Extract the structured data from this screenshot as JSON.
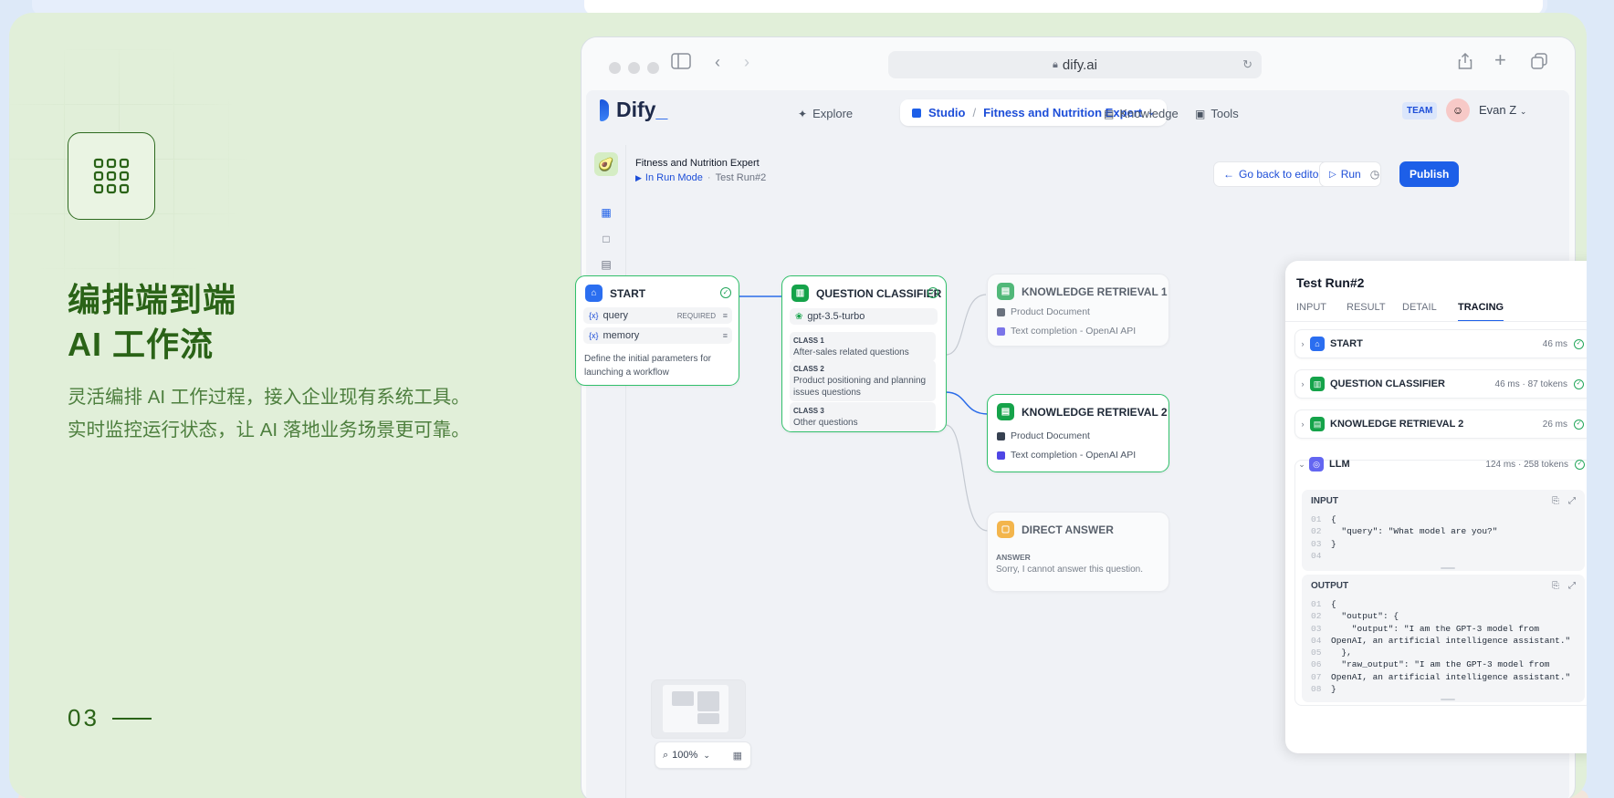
{
  "feature": {
    "title_line1": "编排端到端",
    "title_line2": "AI 工作流",
    "desc_line1": "灵活编排 AI 工作过程，接入企业现有系统工具。",
    "desc_line2": "实时监控运行状态，让 AI 落地业务场景更可靠。",
    "page_number": "03"
  },
  "browser": {
    "url": "dify.ai"
  },
  "nav": {
    "logo": "Dify",
    "explore": "Explore",
    "studio": "Studio",
    "app_name": "Fitness and Nutrition Expert",
    "knowledge": "Knowledge",
    "tools": "Tools",
    "team_badge": "TEAM",
    "user_name": "Evan Z"
  },
  "header": {
    "app_title": "Fitness and Nutrition Expert",
    "run_mode": "In Run Mode",
    "test_run": "Test Run#2",
    "back_button": "Go back to editor",
    "run_button": "Run",
    "publish_button": "Publish"
  },
  "nodes": {
    "start": {
      "title": "START",
      "var1": "query",
      "var1_badge": "REQUIRED",
      "var2": "memory",
      "desc_line1": "Define the initial parameters for",
      "desc_line2": "launching a workflow"
    },
    "classifier": {
      "title": "QUESTION CLASSIFIER",
      "model": "gpt-3.5-turbo",
      "class1_label": "CLASS 1",
      "class1_text": "After-sales related questions",
      "class2_label": "CLASS 2",
      "class2_text_line1": "Product positioning and planning",
      "class2_text_line2": "issues questions",
      "class3_label": "CLASS 3",
      "class3_text": "Other questions"
    },
    "kr1": {
      "title": "KNOWLEDGE RETRIEVAL 1",
      "doc": "Product Document",
      "model": "Text completion - OpenAI API"
    },
    "kr2": {
      "title": "KNOWLEDGE RETRIEVAL 2",
      "doc": "Product Document",
      "model": "Text completion - OpenAI API"
    },
    "answer": {
      "title": "DIRECT ANSWER",
      "label": "ANSWER",
      "text": "Sorry, I cannot answer this question."
    }
  },
  "panel": {
    "title": "Test Run#2",
    "tabs": [
      "INPUT",
      "RESULT",
      "DETAIL",
      "TRACING"
    ],
    "active_tab": "TRACING",
    "trace": [
      {
        "name": "START",
        "meta": "46 ms"
      },
      {
        "name": "QUESTION CLASSIFIER",
        "meta": "46 ms · 87 tokens"
      },
      {
        "name": "KNOWLEDGE RETRIEVAL 2",
        "meta": "26 ms"
      },
      {
        "name": "LLM",
        "meta": "124 ms · 258 tokens"
      }
    ],
    "input_label": "INPUT",
    "input_lines": [
      "{",
      "  \"query\": \"What model are you?\"",
      "}",
      ""
    ],
    "output_label": "OUTPUT",
    "output_lines": [
      "{",
      "  \"output\": {",
      "    \"output\": \"I am the GPT-3 model from",
      "OpenAI, an artificial intelligence assistant.\"",
      "  },",
      "  \"raw_output\": \"I am the GPT-3 model from",
      "OpenAI, an artificial intelligence assistant.\"",
      "}"
    ]
  },
  "canvas": {
    "zoom": "100%"
  },
  "colors": {
    "accent": "#1d5fe8",
    "success": "#22a65a",
    "feature_green": "#2a6317"
  }
}
